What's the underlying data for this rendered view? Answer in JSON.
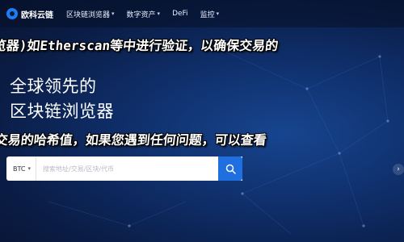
{
  "nav": {
    "brand": "欧科云链",
    "items": [
      {
        "label": "区块链浏览器"
      },
      {
        "label": "数字资产"
      },
      {
        "label": "DeFi"
      },
      {
        "label": "监控"
      }
    ]
  },
  "hero": {
    "line1": "全球领先的",
    "line2": "区块链浏览器"
  },
  "overlay": {
    "line1": "览器)如Etherscan等中进行验证，以确保交易的",
    "line2": "交易的哈希值，如果您遇到任何问题，可以查看"
  },
  "search": {
    "coin": "BTC",
    "placeholder": "搜索地址/交易/区块/代币"
  },
  "colors": {
    "accent": "#1f6fe0",
    "background": "#0b1a3a"
  },
  "icons": {
    "search": "search-icon",
    "chevron": "chevron-down-icon",
    "next": "chevron-right-icon"
  }
}
